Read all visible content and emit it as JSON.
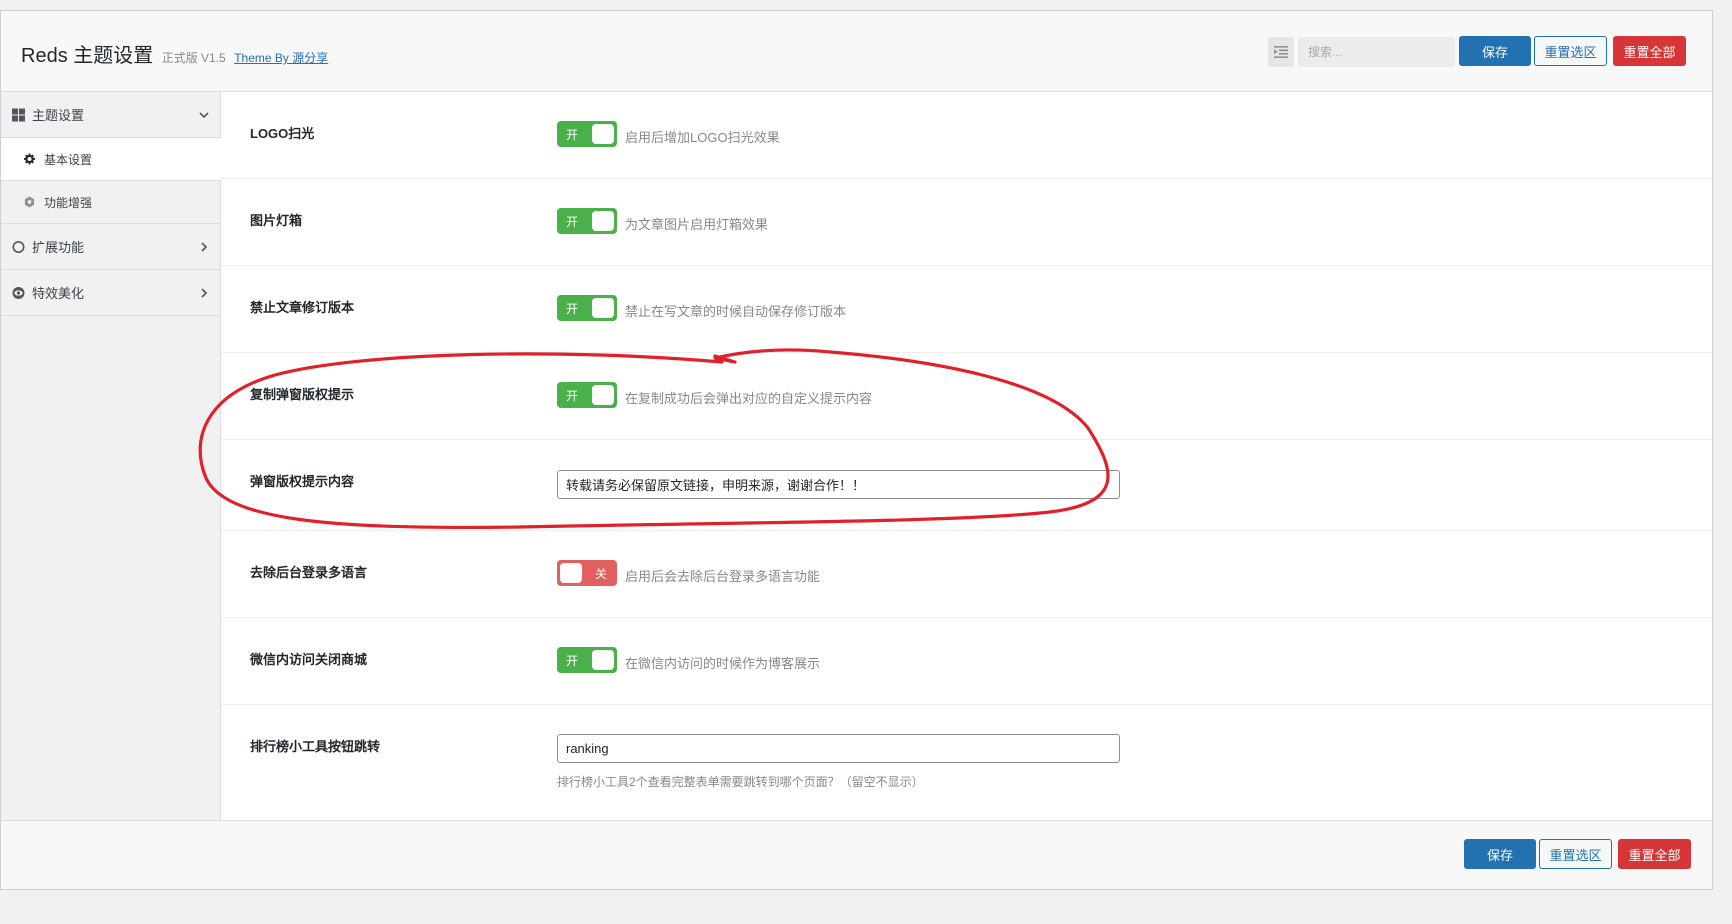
{
  "header": {
    "title": "Reds 主题设置",
    "edition": "正式版 V1.5",
    "theme_link": "Theme By 源分享",
    "search_placeholder": "搜索...",
    "buttons": {
      "save": "保存",
      "reset_section": "重置选区",
      "reset_all": "重置全部"
    }
  },
  "sidebar": {
    "groups": [
      {
        "label": "主题设置",
        "icon": "grid-icon",
        "expanded": true,
        "items": [
          {
            "label": "基本设置",
            "icon": "gear-icon",
            "active": true
          },
          {
            "label": "功能增强",
            "icon": "hexagon-icon",
            "active": false
          }
        ]
      },
      {
        "label": "扩展功能",
        "icon": "circle-icon",
        "expanded": false
      },
      {
        "label": "特效美化",
        "icon": "eye-icon",
        "expanded": false
      }
    ]
  },
  "fields": [
    {
      "label": "LOGO扫光",
      "type": "switch",
      "state": "开",
      "desc": "启用后增加LOGO扫光效果"
    },
    {
      "label": "图片灯箱",
      "type": "switch",
      "state": "开",
      "desc": "为文章图片启用灯箱效果"
    },
    {
      "label": "禁止文章修订版本",
      "type": "switch",
      "state": "开",
      "desc": "禁止在写文章的时候自动保存修订版本"
    },
    {
      "label": "复制弹窗版权提示",
      "type": "switch",
      "state": "开",
      "desc": "在复制成功后会弹出对应的自定义提示内容"
    },
    {
      "label": "弹窗版权提示内容",
      "type": "text",
      "value": "转载请务必保留原文链接，申明来源，谢谢合作！！"
    },
    {
      "label": "去除后台登录多语言",
      "type": "switch",
      "state": "关",
      "desc": "启用后会去除后台登录多语言功能"
    },
    {
      "label": "微信内访问关闭商城",
      "type": "switch",
      "state": "开",
      "desc": "在微信内访问的时候作为博客展示"
    },
    {
      "label": "排行榜小工具按钮跳转",
      "type": "text",
      "value": "ranking",
      "help": "排行榜小工具2个查看完整表单需要跳转到哪个页面？（留空不显示）"
    }
  ],
  "footer": {
    "buttons": {
      "save": "保存",
      "reset_section": "重置选区",
      "reset_all": "重置全部"
    }
  },
  "colors": {
    "primary": "#2271b1",
    "danger": "#d63638",
    "switch_on": "#4ab04a",
    "switch_off": "#e05f5f",
    "annotation": "#e0202a"
  }
}
